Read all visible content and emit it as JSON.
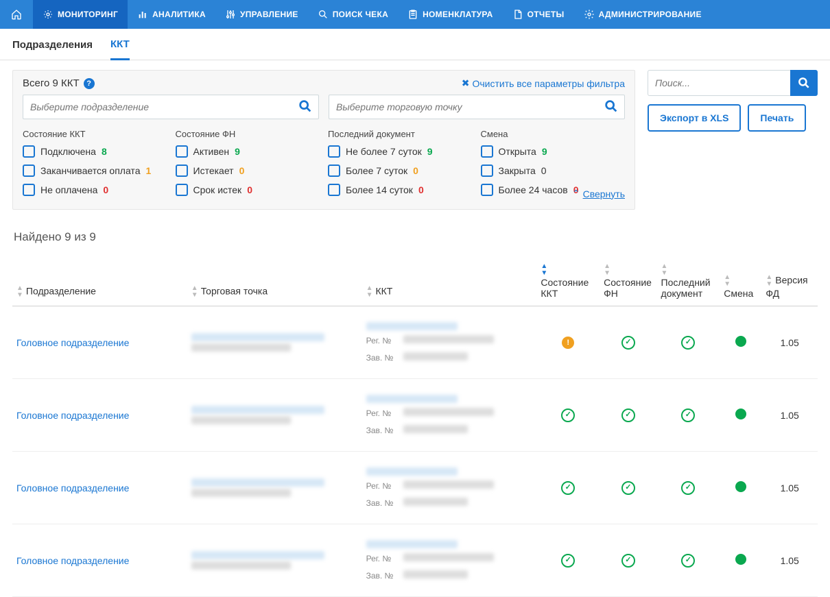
{
  "nav": {
    "items": [
      {
        "label": "МОНИТОРИНГ",
        "active": true
      },
      {
        "label": "АНАЛИТИКА"
      },
      {
        "label": "УПРАВЛЕНИЕ"
      },
      {
        "label": "ПОИСК ЧЕКА"
      },
      {
        "label": "НОМЕНКЛАТУРА"
      },
      {
        "label": "ОТЧЕТЫ"
      },
      {
        "label": "АДМИНИСТРИРОВАНИЕ"
      }
    ]
  },
  "subtabs": {
    "dept": "Подразделения",
    "kkt": "ККТ"
  },
  "filter": {
    "total": "Всего 9 ККТ",
    "clear": "Очистить все параметры фильтра",
    "dept_ph": "Выберите подразделение",
    "point_ph": "Выберите торговую точку",
    "col1_title": "Состояние ККТ",
    "col1": [
      {
        "label": "Подключена",
        "count": "8",
        "cls": "cnt-g"
      },
      {
        "label": "Заканчивается оплата",
        "count": "1",
        "cls": "cnt-o"
      },
      {
        "label": "Не оплачена",
        "count": "0",
        "cls": "cnt-r"
      }
    ],
    "col2_title": "Состояние ФН",
    "col2": [
      {
        "label": "Активен",
        "count": "9",
        "cls": "cnt-g"
      },
      {
        "label": "Истекает",
        "count": "0",
        "cls": "cnt-o"
      },
      {
        "label": "Срок истек",
        "count": "0",
        "cls": "cnt-r"
      }
    ],
    "col3_title": "Последний документ",
    "col3": [
      {
        "label": "Не более 7 суток",
        "count": "9",
        "cls": "cnt-g"
      },
      {
        "label": "Более 7 суток",
        "count": "0",
        "cls": "cnt-o"
      },
      {
        "label": "Более 14 суток",
        "count": "0",
        "cls": "cnt-r"
      }
    ],
    "col4_title": "Смена",
    "col4": [
      {
        "label": "Открыта",
        "count": "9",
        "cls": "cnt-g"
      },
      {
        "label": "Закрыта",
        "count": "0",
        "cls": ""
      },
      {
        "label": "Более 24 часов",
        "count": "0",
        "cls": "cnt-r"
      }
    ],
    "collapse": "Свернуть"
  },
  "side": {
    "search_ph": "Поиск...",
    "export": "Экспорт в XLS",
    "print": "Печать"
  },
  "results": {
    "found": "Найдено 9 из 9",
    "cols": {
      "dept": "Подразделение",
      "point": "Торговая точка",
      "kkt": "ККТ",
      "kkt_state": "Состояние ККТ",
      "fn_state": "Состояние ФН",
      "last_doc": "Последний документ",
      "shift": "Смена",
      "fd_ver": "Версия ФД"
    },
    "reg_label": "Рег. №",
    "zav_label": "Зав. №",
    "rows": [
      {
        "dept": "Головное подразделение",
        "kkt": "warn",
        "fd": "1.05"
      },
      {
        "dept": "Головное подразделение",
        "kkt": "ok",
        "fd": "1.05"
      },
      {
        "dept": "Головное подразделение",
        "kkt": "ok",
        "fd": "1.05"
      },
      {
        "dept": "Головное подразделение",
        "kkt": "ok",
        "fd": "1.05"
      }
    ]
  }
}
